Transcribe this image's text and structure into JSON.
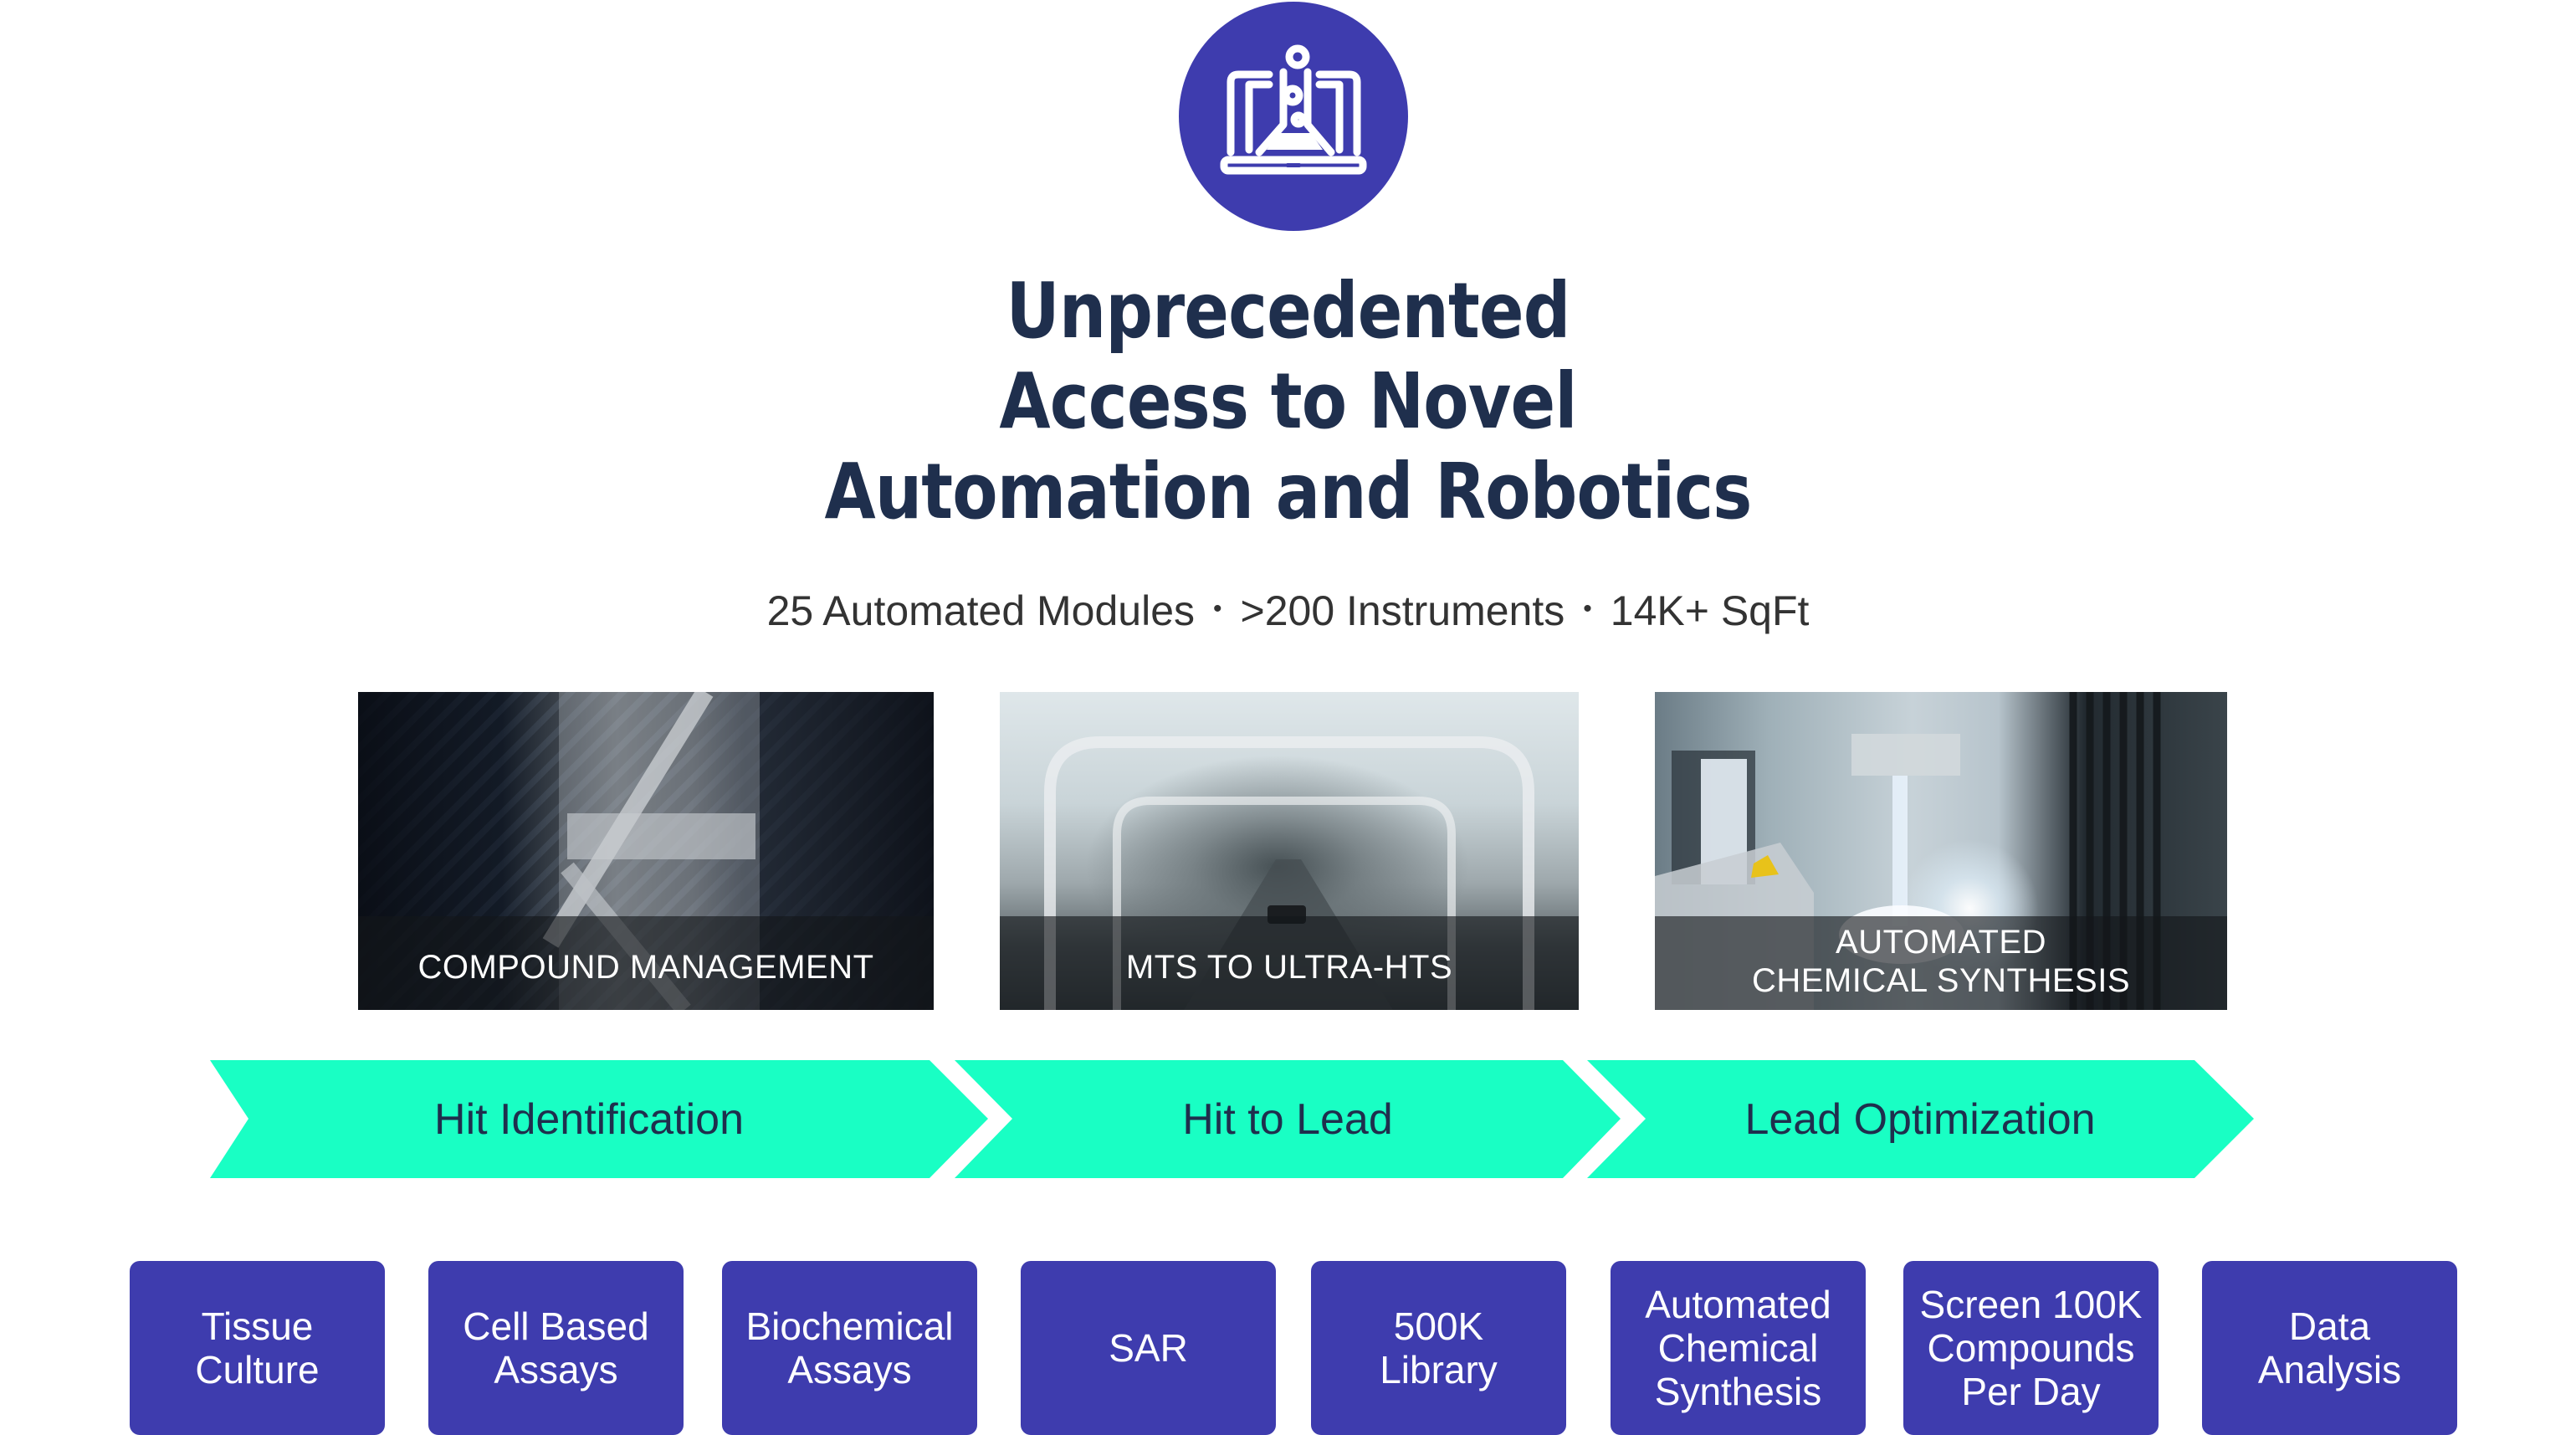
{
  "hero_icon": "laptop-flask-icon",
  "title": {
    "lines": [
      "Unprecedented",
      "Access to Novel",
      "Automation and Robotics"
    ]
  },
  "stats": {
    "items": [
      "25 Automated Modules",
      ">200 Instruments",
      "14K+ SqFt"
    ],
    "separator": "•"
  },
  "photos": [
    {
      "caption_lines": [
        "COMPOUND MANAGEMENT"
      ]
    },
    {
      "caption_lines": [
        "MTS TO ULTRA-HTS"
      ]
    },
    {
      "caption_lines": [
        "AUTOMATED",
        "CHEMICAL SYNTHESIS"
      ]
    }
  ],
  "stages": [
    {
      "label": "Hit Identification"
    },
    {
      "label": "Hit to Lead"
    },
    {
      "label": "Lead Optimization"
    }
  ],
  "capabilities": [
    {
      "lines": [
        "Tissue",
        "Culture"
      ]
    },
    {
      "lines": [
        "Cell Based",
        "Assays"
      ]
    },
    {
      "lines": [
        "Biochemical",
        "Assays"
      ]
    },
    {
      "lines": [
        "SAR"
      ]
    },
    {
      "lines": [
        "500K",
        "Library"
      ]
    },
    {
      "lines": [
        "Automated",
        "Chemical",
        "Synthesis"
      ]
    },
    {
      "lines": [
        "Screen 100K",
        "Compounds",
        "Per Day"
      ]
    },
    {
      "lines": [
        "Data",
        "Analysis"
      ]
    }
  ],
  "colors": {
    "brand_purple": "#3e3cae",
    "stage_green": "#19ffc4",
    "title_navy": "#1f2f4d",
    "stats_gray": "#333333"
  }
}
